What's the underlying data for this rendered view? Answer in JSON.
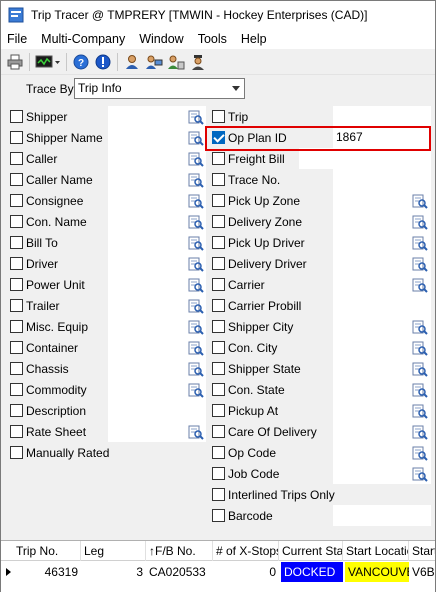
{
  "window": {
    "title": "Trip Tracer @ TMPRERY [TMWIN - Hockey Enterprises (CAD)]"
  },
  "menu": [
    "File",
    "Multi-Company",
    "Window",
    "Tools",
    "Help"
  ],
  "trace": {
    "label": "Trace By",
    "value": "Trip Info"
  },
  "left_fields": [
    {
      "label": "Shipper",
      "checked": false,
      "value": "",
      "lookup": true
    },
    {
      "label": "Shipper Name",
      "checked": false,
      "value": "",
      "lookup": true
    },
    {
      "label": "Caller",
      "checked": false,
      "value": "",
      "lookup": true
    },
    {
      "label": "Caller Name",
      "checked": false,
      "value": "",
      "lookup": true
    },
    {
      "label": "Consignee",
      "checked": false,
      "value": "",
      "lookup": true
    },
    {
      "label": "Con. Name",
      "checked": false,
      "value": "",
      "lookup": true
    },
    {
      "label": "Bill To",
      "checked": false,
      "value": "",
      "lookup": true
    },
    {
      "label": "Driver",
      "checked": false,
      "value": "",
      "lookup": true
    },
    {
      "label": "Power Unit",
      "checked": false,
      "value": "",
      "lookup": true
    },
    {
      "label": "Trailer",
      "checked": false,
      "value": "",
      "lookup": true
    },
    {
      "label": "Misc. Equip",
      "checked": false,
      "value": "",
      "lookup": true
    },
    {
      "label": "Container",
      "checked": false,
      "value": "",
      "lookup": true
    },
    {
      "label": "Chassis",
      "checked": false,
      "value": "",
      "lookup": true
    },
    {
      "label": "Commodity",
      "checked": false,
      "value": "",
      "lookup": true
    },
    {
      "label": "Description",
      "checked": false,
      "value": "",
      "lookup": false
    },
    {
      "label": "Rate Sheet",
      "checked": false,
      "value": "",
      "lookup": true
    },
    {
      "label": "Manually Rated",
      "checked": false,
      "value": null,
      "lookup": false
    }
  ],
  "right_fields": [
    {
      "label": "Trip",
      "checked": false,
      "value": "",
      "lookup": false
    },
    {
      "label": "Op Plan ID",
      "checked": true,
      "value": "1867",
      "lookup": false
    },
    {
      "label": "Freight Bill",
      "checked": false,
      "value": "",
      "lookup": false
    },
    {
      "label": "Trace No.",
      "checked": false,
      "value": "",
      "lookup": false
    },
    {
      "label": "Pick Up Zone",
      "checked": false,
      "value": "",
      "lookup": true
    },
    {
      "label": "Delivery Zone",
      "checked": false,
      "value": "",
      "lookup": true
    },
    {
      "label": "Pick Up Driver",
      "checked": false,
      "value": "",
      "lookup": true
    },
    {
      "label": "Delivery Driver",
      "checked": false,
      "value": "",
      "lookup": true
    },
    {
      "label": "Carrier",
      "checked": false,
      "value": "",
      "lookup": true
    },
    {
      "label": "Carrier Probill",
      "checked": false,
      "value": "",
      "lookup": false
    },
    {
      "label": "Shipper City",
      "checked": false,
      "value": "",
      "lookup": true
    },
    {
      "label": "Con. City",
      "checked": false,
      "value": "",
      "lookup": true
    },
    {
      "label": "Shipper State",
      "checked": false,
      "value": "",
      "lookup": true
    },
    {
      "label": "Con. State",
      "checked": false,
      "value": "",
      "lookup": true
    },
    {
      "label": "Pickup At",
      "checked": false,
      "value": "",
      "lookup": true
    },
    {
      "label": "Care Of Delivery",
      "checked": false,
      "value": "",
      "lookup": true
    },
    {
      "label": "Op Code",
      "checked": false,
      "value": "",
      "lookup": true
    },
    {
      "label": "Job Code",
      "checked": false,
      "value": "",
      "lookup": true
    },
    {
      "label": "Interlined Trips Only",
      "checked": false,
      "value": null,
      "lookup": false
    },
    {
      "label": "Barcode",
      "checked": false,
      "value": "",
      "lookup": false
    }
  ],
  "grid": {
    "columns": [
      "Trip No.",
      "Leg",
      "↑F/B No.",
      "# of X-Stops",
      "Current Status",
      "Start Location",
      "Start"
    ],
    "rows": [
      [
        "46319",
        "3",
        "CA020533",
        "0",
        "DOCKED",
        "VANCOUVER",
        "V6B"
      ]
    ]
  },
  "colors": {
    "status_bg": "#0000ff",
    "location_bg": "#ffff00",
    "highlight_border": "#e00000",
    "checkbox_checked": "#0067c0"
  }
}
